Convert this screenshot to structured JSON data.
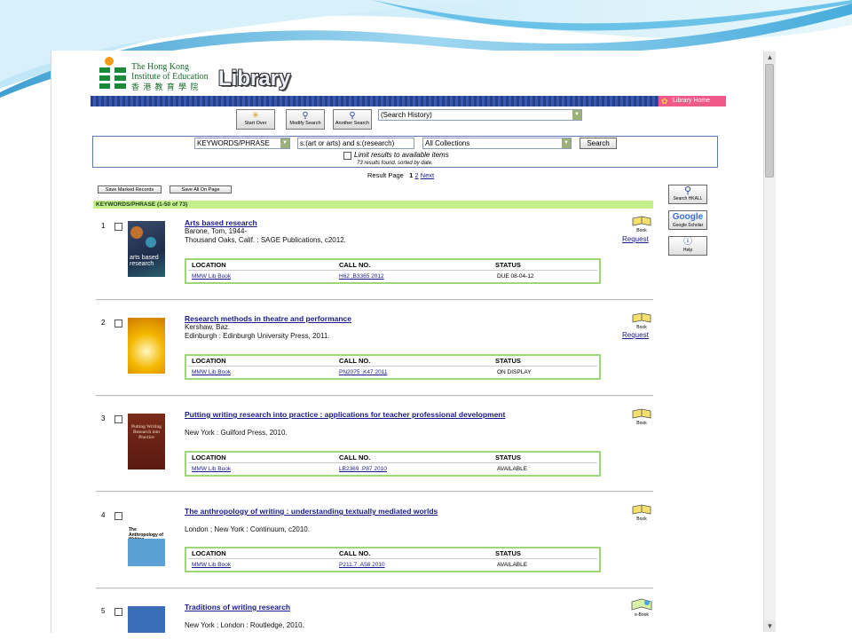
{
  "header": {
    "institution_en": "The Hong Kong Institute of Education",
    "institution_zh": "香 港 教 育 學 院",
    "library_word": "Library",
    "library_home": "Library Home"
  },
  "toolbar": {
    "start_over": "Start Over",
    "modify_search": "Modify Search",
    "another_search": "Another Search",
    "history_select": "(Search History)"
  },
  "search": {
    "field_select": "KEYWORDS/PHRASE",
    "query": "s:(art or arts) and s:(research)",
    "collection_select": "All Collections",
    "search_button": "Search",
    "limit_label": "Limit results to available items",
    "results_summary": "73 results found. sorted by date."
  },
  "pagination": {
    "label": "Result Page",
    "current": "1",
    "page2": "2",
    "next": "Next"
  },
  "actions": {
    "save_marked": "Save Marked Records",
    "save_all": "Save All On Page"
  },
  "results_header": "KEYWORDS/PHRASE (1-50 of 73)",
  "sidebar": {
    "search_hkall": "Search HKALL",
    "google_word": "Google",
    "google_scholar": "Google Scholar",
    "help": "Help"
  },
  "table_headers": {
    "location": "LOCATION",
    "call_no": "CALL NO.",
    "status": "STATUS"
  },
  "records": [
    {
      "number": "1",
      "title": "Arts based research",
      "author": "Barone, Tom, 1944-",
      "publication": "Thousand Oaks, Calif. : SAGE Publications, c2012.",
      "location": "MMW Lib Book",
      "call_no": "H62 .B3365 2012",
      "status": "DUE 08-04-12",
      "format": "Book",
      "request": "Request",
      "cover_text": "arts based research"
    },
    {
      "number": "2",
      "title": "Research methods in theatre and performance",
      "author": "Kershaw, Baz.",
      "publication": "Edinburgh : Edinburgh University Press, 2011.",
      "location": "MMW Lib Book",
      "call_no": "PN2075 .K47 2011",
      "status": "ON DISPLAY",
      "format": "Book",
      "request": "Request"
    },
    {
      "number": "3",
      "title": "Putting writing research into practice : applications for teacher professional development",
      "publication": "New York : Guilford Press, 2010.",
      "location": "MMW Lib Book",
      "call_no": "LB2369 .P87 2010",
      "status": "AVAILABLE",
      "format": "Book",
      "cover_text": "Putting Writing Research into Practice"
    },
    {
      "number": "4",
      "title": "The anthropology of writing : understanding textually mediated worlds",
      "publication": "London ; New York : Continuum, c2010.",
      "location": "MMW Lib Book",
      "call_no": "P211.7 .A58 2010",
      "status": "AVAILABLE",
      "format": "Book",
      "cover_text": "The Anthropology of Writing"
    },
    {
      "number": "5",
      "title": "Traditions of writing research",
      "publication": "New York ; London : Routledge, 2010.",
      "format": "e-Book"
    }
  ],
  "colors": {
    "link": "#1a1a8a",
    "banner_blue": "#27408b",
    "library_home_pink": "#f05a8a",
    "results_header_green": "#c5ef8a",
    "table_border_green": "#9ed67a",
    "logo_green": "#1a6b2a"
  }
}
